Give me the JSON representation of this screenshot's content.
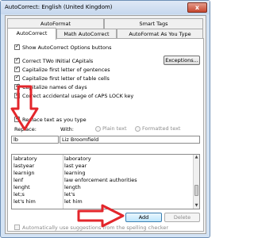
{
  "window": {
    "title": "AutoCorrect: English (United Kingdom)",
    "close_glyph": "x"
  },
  "tabs": {
    "row1": [
      "AutoFormat",
      "Smart Tags"
    ],
    "row2": [
      "AutoCorrect",
      "Math AutoCorrect",
      "AutoFormat As You Type"
    ],
    "active": "AutoCorrect"
  },
  "options": [
    {
      "label": "Show AutoCorrect Options buttons",
      "checked": true
    },
    {
      "label": "Correct TWo INitial CApitals",
      "checked": true
    },
    {
      "label": "Capitalize first letter of gentences",
      "checked": true
    },
    {
      "label": "Capitalize first letter of table cells",
      "checked": true
    },
    {
      "label": "Capitalize names of days",
      "checked": true
    },
    {
      "label": "Correct accidental usage of cAPS LOCK key",
      "checked": true
    }
  ],
  "exceptions_label": "Exceptions...",
  "replace_toggle": {
    "label": "Replace text as you type",
    "checked": true
  },
  "replace_label": "Replace:",
  "with_label": "With:",
  "plain_text_label": "Plain text",
  "formatted_text_label": "Formatted text",
  "replace_value": "lb",
  "with_value": "Liz Broomfield",
  "entries": [
    {
      "from": "labratory",
      "to": "laboratory"
    },
    {
      "from": "lastyear",
      "to": "last year"
    },
    {
      "from": "learnign",
      "to": "learning"
    },
    {
      "from": "lenf",
      "to": "law enforcement authorities"
    },
    {
      "from": "lenght",
      "to": "length"
    },
    {
      "from": "let;s",
      "to": "let's"
    },
    {
      "from": "let's him",
      "to": "let him"
    }
  ],
  "add_label": "Add",
  "delete_label": "Delete",
  "auto_suggest": {
    "label": "Automatically use suggestions from the spelling checker",
    "checked": false
  },
  "colors": {
    "annotation_arrow": "#e3262b"
  }
}
